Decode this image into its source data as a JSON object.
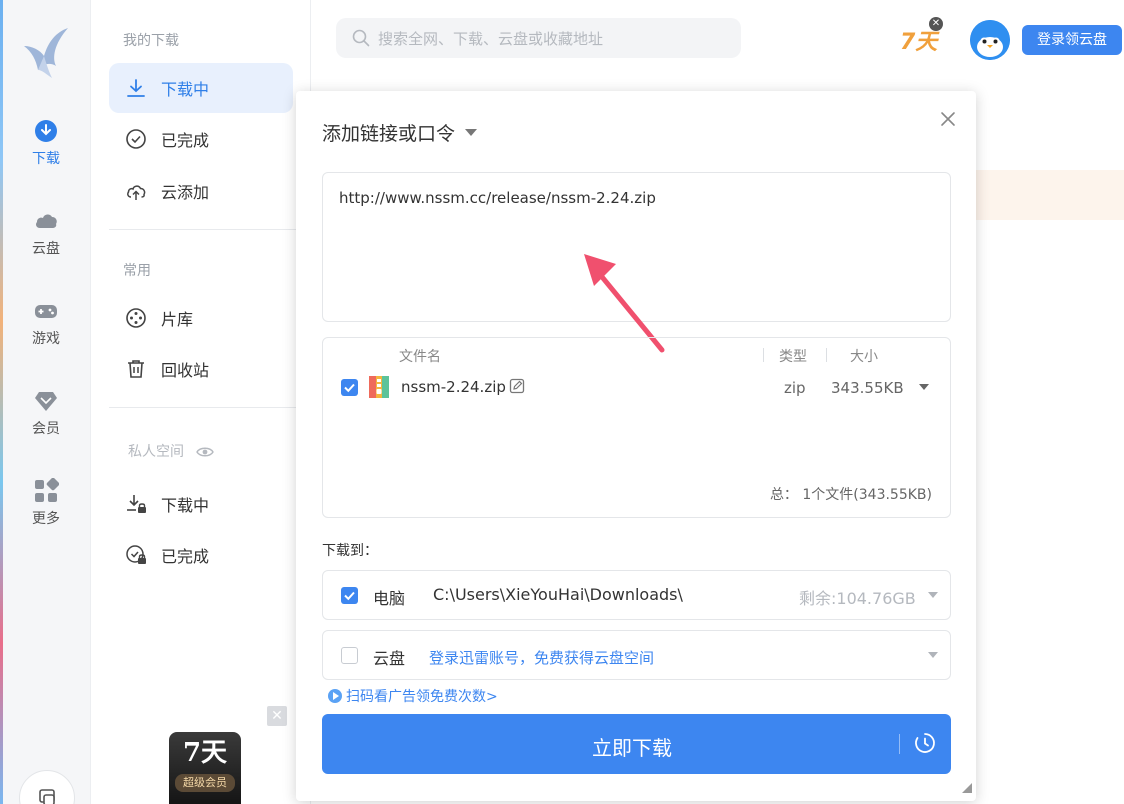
{
  "rail": {
    "items": [
      {
        "label": "下载",
        "icon": "download-circle-icon"
      },
      {
        "label": "云盘",
        "icon": "cloud-icon"
      },
      {
        "label": "游戏",
        "icon": "gamepad-icon"
      },
      {
        "label": "会员",
        "icon": "diamond-icon"
      },
      {
        "label": "更多",
        "icon": "grid-icon"
      }
    ]
  },
  "sidebar": {
    "my_downloads_title": "我的下载",
    "common_title": "常用",
    "private_title": "私人空间",
    "downloading": "下载中",
    "completed": "已完成",
    "cloud_add": "云添加",
    "library": "片库",
    "recycle": "回收站",
    "private_downloading": "下载中",
    "private_completed": "已完成",
    "promo_big": "7天",
    "promo_small": "超级会员"
  },
  "topbar": {
    "search_placeholder": "搜索全网、下载、云盘或收藏地址",
    "badge": "7天",
    "login_button": "登录领云盘"
  },
  "dialog": {
    "title": "添加链接或口令",
    "url": "http://www.nssm.cc/release/nssm-2.24.zip",
    "columns": {
      "name": "文件名",
      "type": "类型",
      "size": "大小"
    },
    "file": {
      "name": "nssm-2.24.zip",
      "type": "zip",
      "size": "343.55KB",
      "checked": true
    },
    "total": "总： 1个文件(343.55KB)",
    "download_to_label": "下载到：",
    "pc": {
      "name": "电脑",
      "path": "C:\\Users\\XieYouHai\\Downloads\\",
      "free": "剩余:104.76GB",
      "checked": true
    },
    "cloud": {
      "name": "云盘",
      "link": "登录迅雷账号，免费获得云盘空间",
      "checked": false
    },
    "ad_link": "扫码看广告领免费次数>",
    "download_button": "立即下载"
  },
  "colors": {
    "accent": "#3d86f0",
    "active_bg": "#e8f0fd",
    "badge": "#f0a03c"
  }
}
